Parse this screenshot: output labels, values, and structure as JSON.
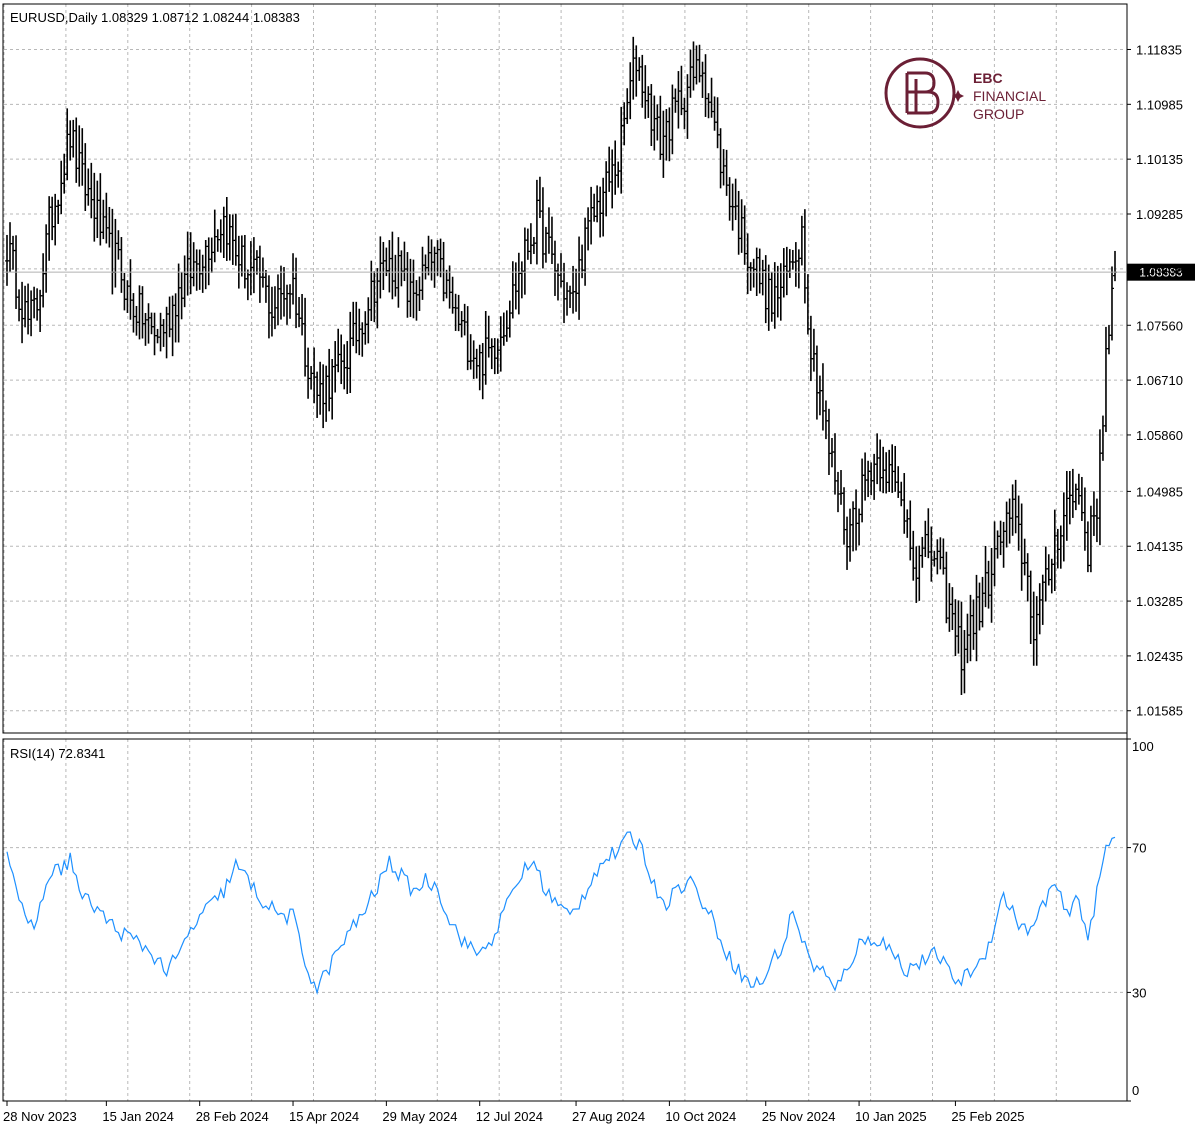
{
  "header": {
    "title": "EURUSD,Daily 1.08329 1.08712 1.08244 1.08383"
  },
  "logo": {
    "line1": "EBC",
    "line2": "FINANCIAL",
    "line3": "GROUP",
    "color": "#6b1f35"
  },
  "colors": {
    "bars": "#000000",
    "rsi_line": "#1e90ff",
    "grid": "#b8b8b8",
    "price_line": "#b0b0b0",
    "price_label_bg": "#000000",
    "price_label_text": "#ffffff"
  },
  "chart_data": [
    {
      "type": "ohlc",
      "series_label": "EURUSD,Daily",
      "last_ohlc": {
        "open": 1.08329,
        "high": 1.08712,
        "low": 1.08244,
        "close": 1.08383
      },
      "current_price_label": "1.08383",
      "ylim": [
        1.0124,
        1.1254
      ],
      "y_ticks": [
        "1.11835",
        "1.10985",
        "1.10135",
        "1.09285",
        "1.08435",
        "1.07560",
        "1.06710",
        "1.05860",
        "1.04985",
        "1.04135",
        "1.03285",
        "1.02435",
        "1.01585"
      ],
      "x_ticks": [
        "28 Nov 2023",
        "15 Jan 2024",
        "28 Feb 2024",
        "15 Apr 2024",
        "29 May 2024",
        "12 Jul 2024",
        "27 Aug 2024",
        "10 Oct 2024",
        "25 Nov 2024",
        "10 Jan 2025",
        "25 Feb 2025"
      ],
      "grid": true,
      "anchors_close": [
        [
          0,
          1.088
        ],
        [
          4,
          1.081
        ],
        [
          7,
          1.076
        ],
        [
          10,
          1.079
        ],
        [
          14,
          1.091
        ],
        [
          18,
          1.099
        ],
        [
          21,
          1.105
        ],
        [
          25,
          1.098
        ],
        [
          29,
          1.094
        ],
        [
          33,
          1.088
        ],
        [
          37,
          1.085
        ],
        [
          41,
          1.079
        ],
        [
          45,
          1.077
        ],
        [
          49,
          1.074
        ],
        [
          53,
          1.076
        ],
        [
          57,
          1.081
        ],
        [
          61,
          1.084
        ],
        [
          64,
          1.086
        ],
        [
          68,
          1.089
        ],
        [
          72,
          1.092
        ],
        [
          76,
          1.087
        ],
        [
          80,
          1.084
        ],
        [
          84,
          1.083
        ],
        [
          88,
          1.078
        ],
        [
          92,
          1.081
        ],
        [
          95,
          1.082
        ],
        [
          99,
          1.072
        ],
        [
          103,
          1.065
        ],
        [
          107,
          1.067
        ],
        [
          111,
          1.069
        ],
        [
          115,
          1.073
        ],
        [
          119,
          1.078
        ],
        [
          122,
          1.082
        ],
        [
          126,
          1.085
        ],
        [
          130,
          1.084
        ],
        [
          134,
          1.08
        ],
        [
          138,
          1.083
        ],
        [
          142,
          1.086
        ],
        [
          146,
          1.081
        ],
        [
          149,
          1.077
        ],
        [
          153,
          1.073
        ],
        [
          157,
          1.07
        ],
        [
          161,
          1.072
        ],
        [
          165,
          1.076
        ],
        [
          169,
          1.082
        ],
        [
          173,
          1.088
        ],
        [
          176,
          1.092
        ],
        [
          180,
          1.087
        ],
        [
          184,
          1.082
        ],
        [
          188,
          1.079
        ],
        [
          191,
          1.087
        ],
        [
          195,
          1.093
        ],
        [
          199,
          1.097
        ],
        [
          203,
          1.101
        ],
        [
          206,
          1.11
        ],
        [
          209,
          1.117
        ],
        [
          213,
          1.11
        ],
        [
          217,
          1.104
        ],
        [
          220,
          1.107
        ],
        [
          224,
          1.111
        ],
        [
          228,
          1.114
        ],
        [
          231,
          1.116
        ],
        [
          235,
          1.106
        ],
        [
          238,
          1.099
        ],
        [
          242,
          1.093
        ],
        [
          246,
          1.087
        ],
        [
          250,
          1.083
        ],
        [
          254,
          1.079
        ],
        [
          258,
          1.082
        ],
        [
          261,
          1.086
        ],
        [
          264,
          1.09
        ],
        [
          267,
          1.072
        ],
        [
          270,
          1.066
        ],
        [
          273,
          1.056
        ],
        [
          276,
          1.05
        ],
        [
          279,
          1.043
        ],
        [
          283,
          1.049
        ],
        [
          287,
          1.054
        ],
        [
          291,
          1.055
        ],
        [
          295,
          1.05
        ],
        [
          299,
          1.046
        ],
        [
          302,
          1.038
        ],
        [
          306,
          1.041
        ],
        [
          309,
          1.039
        ],
        [
          313,
          1.031
        ],
        [
          317,
          1.025
        ],
        [
          320,
          1.029
        ],
        [
          324,
          1.033
        ],
        [
          327,
          1.038
        ],
        [
          331,
          1.044
        ],
        [
          334,
          1.046
        ],
        [
          338,
          1.039
        ],
        [
          341,
          1.029
        ],
        [
          345,
          1.035
        ],
        [
          348,
          1.042
        ],
        [
          352,
          1.048
        ],
        [
          356,
          1.05
        ],
        [
          359,
          1.041
        ],
        [
          362,
          1.048
        ],
        [
          365,
          1.07
        ],
        [
          367,
          1.08
        ],
        [
          368,
          1.0838
        ]
      ]
    },
    {
      "type": "line",
      "series_label": "RSI(14) 72.8341",
      "ylim": [
        0,
        100
      ],
      "y_ticks": [
        "100",
        "70",
        "30",
        "0"
      ],
      "grid": true,
      "anchors": [
        [
          0,
          70
        ],
        [
          4,
          56
        ],
        [
          7,
          47
        ],
        [
          10,
          50
        ],
        [
          14,
          63
        ],
        [
          18,
          64
        ],
        [
          21,
          67
        ],
        [
          25,
          56
        ],
        [
          29,
          54
        ],
        [
          33,
          50
        ],
        [
          37,
          47
        ],
        [
          41,
          45
        ],
        [
          45,
          43
        ],
        [
          49,
          40
        ],
        [
          53,
          36
        ],
        [
          57,
          40
        ],
        [
          61,
          47
        ],
        [
          65,
          52
        ],
        [
          69,
          55
        ],
        [
          72,
          58
        ],
        [
          76,
          65
        ],
        [
          80,
          61
        ],
        [
          84,
          56
        ],
        [
          88,
          53
        ],
        [
          92,
          51
        ],
        [
          95,
          51
        ],
        [
          99,
          38
        ],
        [
          103,
          31
        ],
        [
          107,
          37
        ],
        [
          111,
          43
        ],
        [
          115,
          48
        ],
        [
          119,
          53
        ],
        [
          123,
          59
        ],
        [
          127,
          66
        ],
        [
          131,
          62
        ],
        [
          135,
          58
        ],
        [
          139,
          61
        ],
        [
          143,
          59
        ],
        [
          147,
          50
        ],
        [
          151,
          45
        ],
        [
          155,
          41
        ],
        [
          159,
          42
        ],
        [
          163,
          48
        ],
        [
          167,
          56
        ],
        [
          171,
          63
        ],
        [
          175,
          66
        ],
        [
          179,
          58
        ],
        [
          183,
          54
        ],
        [
          187,
          51
        ],
        [
          191,
          56
        ],
        [
          195,
          63
        ],
        [
          199,
          67
        ],
        [
          203,
          69
        ],
        [
          207,
          73
        ],
        [
          211,
          70
        ],
        [
          215,
          59
        ],
        [
          219,
          55
        ],
        [
          223,
          59
        ],
        [
          227,
          61
        ],
        [
          231,
          55
        ],
        [
          235,
          49
        ],
        [
          239,
          41
        ],
        [
          243,
          36
        ],
        [
          247,
          32
        ],
        [
          251,
          33
        ],
        [
          255,
          40
        ],
        [
          258,
          43
        ],
        [
          261,
          53
        ],
        [
          264,
          45
        ],
        [
          267,
          38
        ],
        [
          271,
          36
        ],
        [
          275,
          30
        ],
        [
          279,
          37
        ],
        [
          283,
          43
        ],
        [
          287,
          45
        ],
        [
          291,
          44
        ],
        [
          295,
          40
        ],
        [
          299,
          36
        ],
        [
          302,
          38
        ],
        [
          306,
          39
        ],
        [
          309,
          41
        ],
        [
          313,
          35
        ],
        [
          317,
          33
        ],
        [
          320,
          36
        ],
        [
          324,
          39
        ],
        [
          327,
          46
        ],
        [
          331,
          57
        ],
        [
          334,
          52
        ],
        [
          338,
          47
        ],
        [
          341,
          48
        ],
        [
          345,
          56
        ],
        [
          348,
          60
        ],
        [
          352,
          51
        ],
        [
          356,
          56
        ],
        [
          359,
          45
        ],
        [
          362,
          57
        ],
        [
          365,
          70
        ],
        [
          368,
          72.8341
        ]
      ]
    }
  ]
}
